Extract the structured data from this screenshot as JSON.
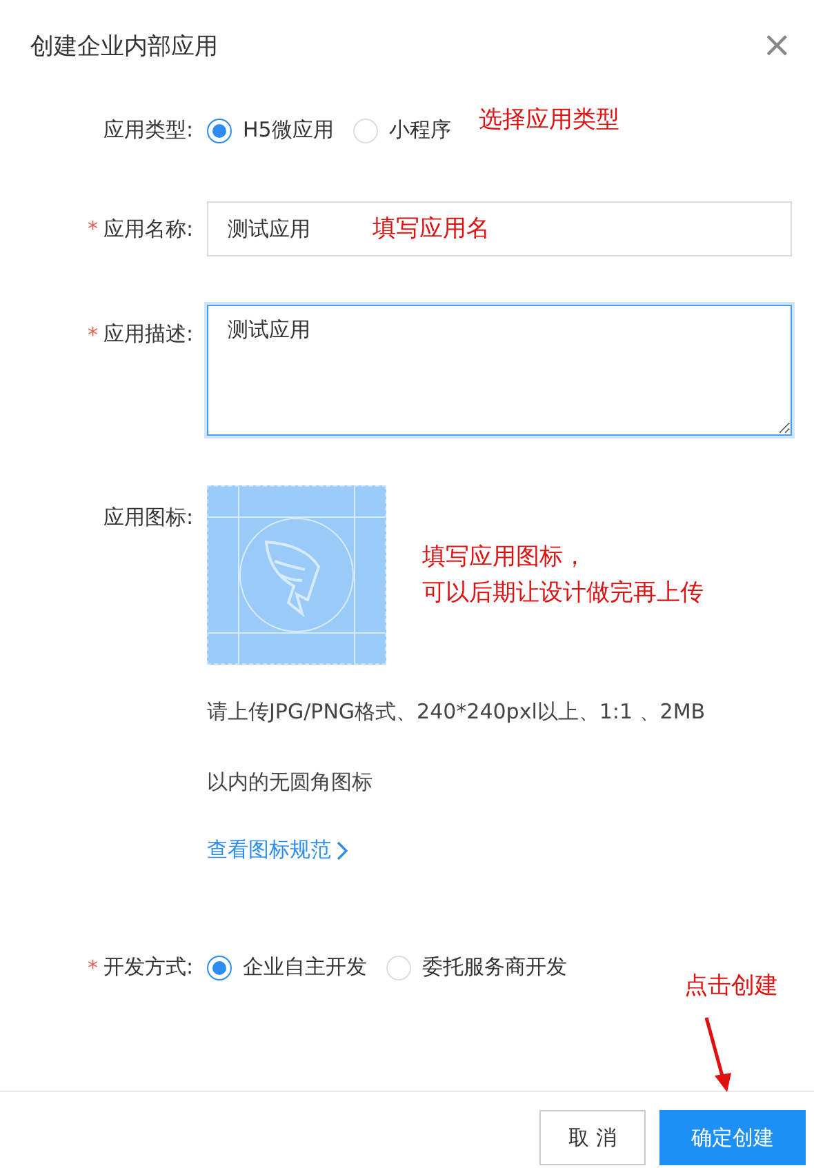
{
  "dialog": {
    "title": "创建企业内部应用",
    "close": "×"
  },
  "app_type": {
    "label": "应用类型:",
    "options": [
      {
        "label": "H5微应用",
        "selected": true
      },
      {
        "label": "小程序",
        "selected": false
      }
    ],
    "annotation": "选择应用类型"
  },
  "app_name": {
    "required_mark": "*",
    "label": "应用名称:",
    "value": "测试应用",
    "annotation": "填写应用名"
  },
  "app_description": {
    "required_mark": "*",
    "label": "应用描述:",
    "value": "测试应用",
    "focused": true
  },
  "app_icon": {
    "label": "应用图标:",
    "annotation_lines": [
      "填写应用图标，",
      "可以后期让设计做完再上传"
    ],
    "help_lines": [
      "请上传JPG/PNG格式、240*240pxl以上、1:1 、2MB",
      "以内的无圆角图标"
    ],
    "link": "查看图标规范"
  },
  "dev_mode": {
    "required_mark": "*",
    "label": "开发方式:",
    "options": [
      {
        "label": "企业自主开发",
        "selected": true
      },
      {
        "label": "委托服务商开发",
        "selected": false
      }
    ]
  },
  "submit_annotation": "点击创建",
  "buttons": [
    {
      "label": "取 消",
      "kind": "secondary"
    },
    {
      "label": "确定创建",
      "kind": "primary"
    }
  ]
}
